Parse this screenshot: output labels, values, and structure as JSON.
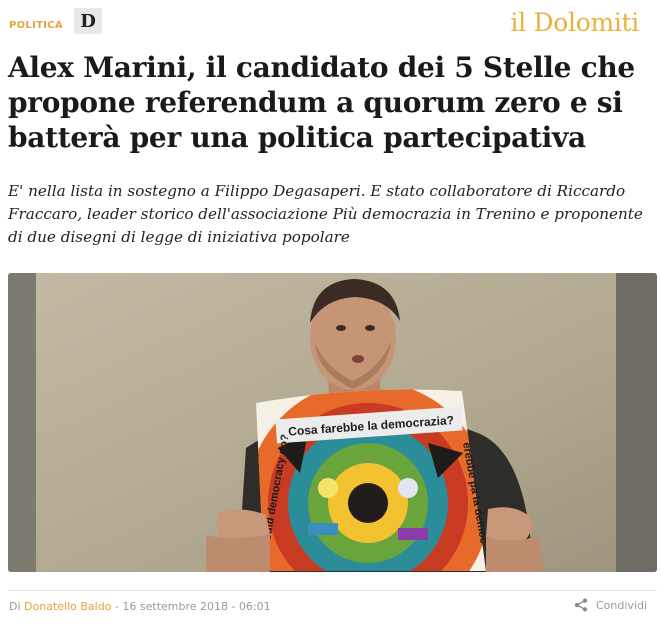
{
  "header": {
    "section": "POLITICA",
    "logo_letter": "D",
    "brand": "il Dolomiti"
  },
  "article": {
    "title": "Alex Marini, il candidato dei 5 Stelle che propone referendum a quorum zero e si batterà per una politica partecipativa",
    "subtitle": "E' nella lista in sostegno a Filippo Degasaperi. E stato collaboratore di Riccardo Fraccaro, leader storico dell'associazione Più democrazia in Trenino e proponente di due disegni di legge di iniziativa popolare",
    "photo": {
      "poster_text": "Cosa farebbe la democrazia?",
      "poster_left_text": "ould democracy do?",
      "poster_right_text": "erebbe pa la democ"
    }
  },
  "meta": {
    "by_prefix": "Di ",
    "author": "Donatello Baldo",
    "date": " - 16 settembre 2018 - 06:01",
    "share_label": "Condividi",
    "share_icon": "share-icon"
  },
  "colors": {
    "accent": "#e8a33a",
    "brand": "#e9b23a",
    "text": "#1a1a1a"
  }
}
